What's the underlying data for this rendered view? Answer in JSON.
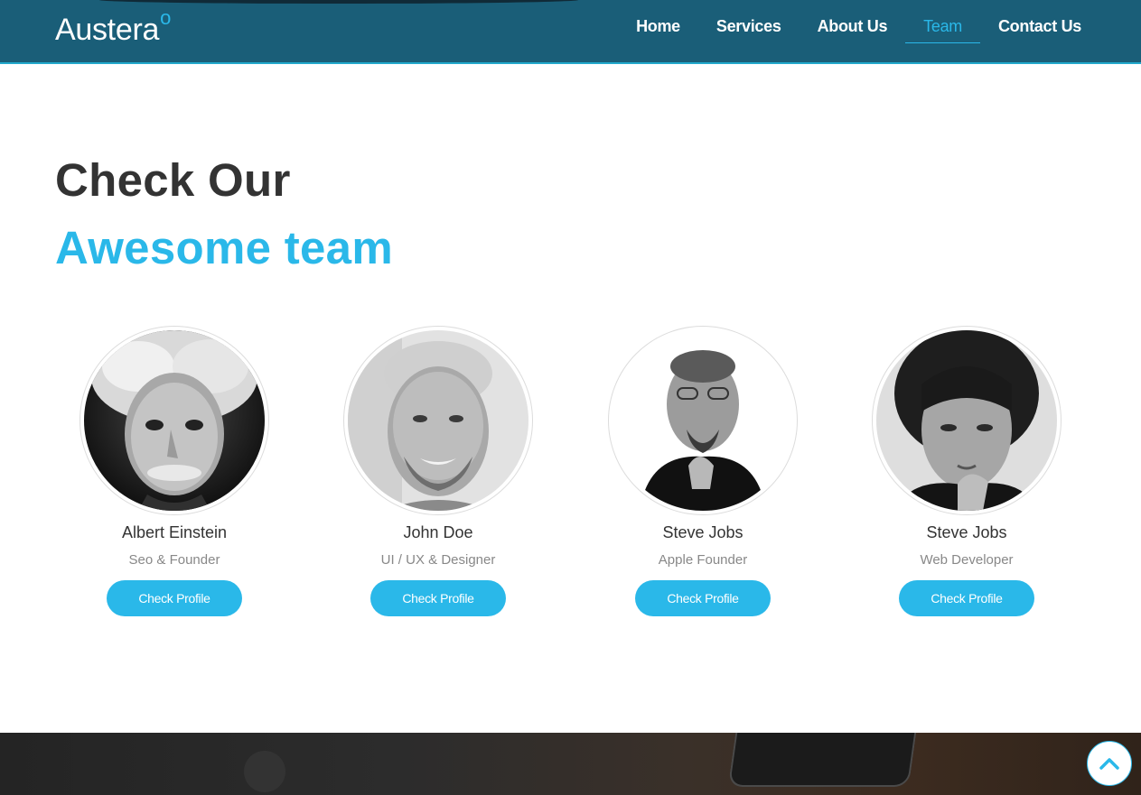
{
  "brand": {
    "name": "Austera",
    "mark": "o"
  },
  "nav": {
    "items": [
      {
        "label": "Home"
      },
      {
        "label": "Services"
      },
      {
        "label": "About Us"
      },
      {
        "label": "Team",
        "active": true
      },
      {
        "label": "Contact Us"
      }
    ]
  },
  "section": {
    "title_line1": "Check Our",
    "title_line2": "Awesome team"
  },
  "team": {
    "members": [
      {
        "name": "Albert Einstein",
        "role": "Seo & Founder",
        "button": "Check Profile"
      },
      {
        "name": "John Doe",
        "role": "UI / UX & Designer",
        "button": "Check Profile"
      },
      {
        "name": "Steve Jobs",
        "role": "Apple Founder",
        "button": "Check Profile"
      },
      {
        "name": "Steve Jobs",
        "role": "Web Developer",
        "button": "Check Profile"
      }
    ]
  },
  "icons": {
    "scroll_top": "chevron-up-icon"
  },
  "colors": {
    "header_bg": "#1a5e78",
    "accent": "#2ab8e9",
    "heading": "#333333",
    "muted": "#888888"
  }
}
